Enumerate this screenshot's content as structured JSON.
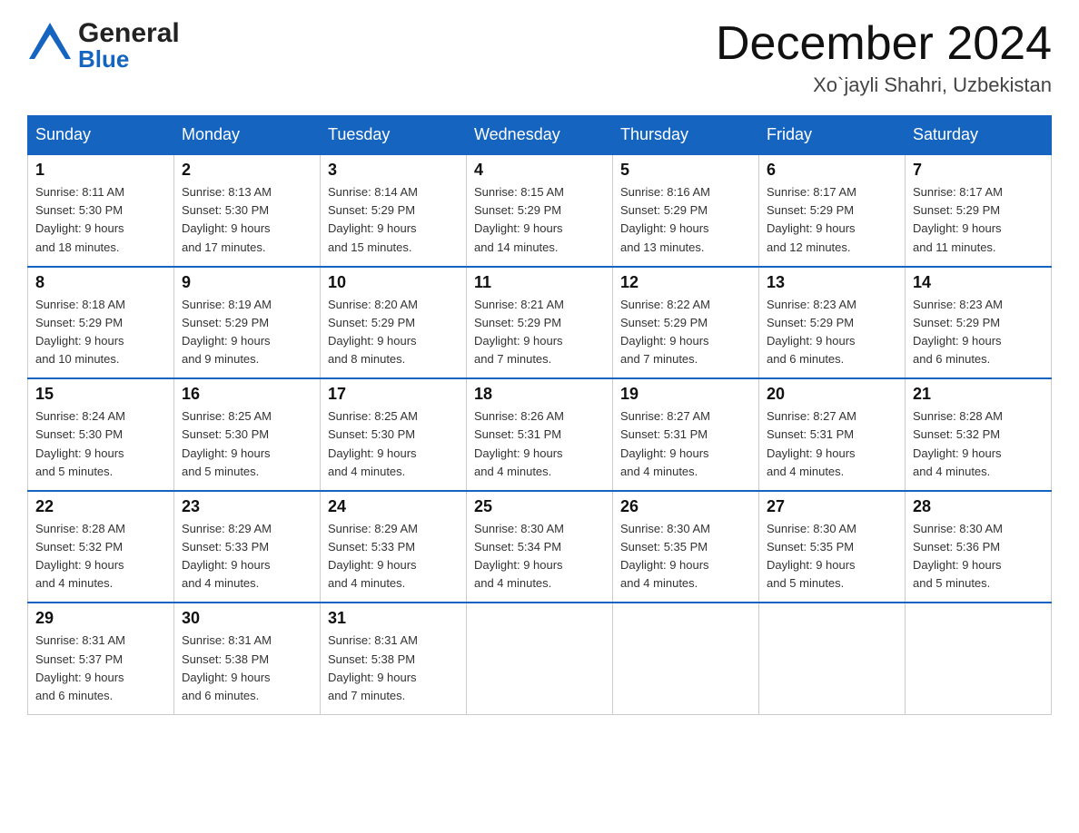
{
  "header": {
    "logo_general": "General",
    "logo_blue": "Blue",
    "month_title": "December 2024",
    "location": "Xo`jayli Shahri, Uzbekistan"
  },
  "days_of_week": [
    "Sunday",
    "Monday",
    "Tuesday",
    "Wednesday",
    "Thursday",
    "Friday",
    "Saturday"
  ],
  "weeks": [
    [
      {
        "day": "1",
        "sunrise": "8:11 AM",
        "sunset": "5:30 PM",
        "daylight": "9 hours and 18 minutes."
      },
      {
        "day": "2",
        "sunrise": "8:13 AM",
        "sunset": "5:30 PM",
        "daylight": "9 hours and 17 minutes."
      },
      {
        "day": "3",
        "sunrise": "8:14 AM",
        "sunset": "5:29 PM",
        "daylight": "9 hours and 15 minutes."
      },
      {
        "day": "4",
        "sunrise": "8:15 AM",
        "sunset": "5:29 PM",
        "daylight": "9 hours and 14 minutes."
      },
      {
        "day": "5",
        "sunrise": "8:16 AM",
        "sunset": "5:29 PM",
        "daylight": "9 hours and 13 minutes."
      },
      {
        "day": "6",
        "sunrise": "8:17 AM",
        "sunset": "5:29 PM",
        "daylight": "9 hours and 12 minutes."
      },
      {
        "day": "7",
        "sunrise": "8:17 AM",
        "sunset": "5:29 PM",
        "daylight": "9 hours and 11 minutes."
      }
    ],
    [
      {
        "day": "8",
        "sunrise": "8:18 AM",
        "sunset": "5:29 PM",
        "daylight": "9 hours and 10 minutes."
      },
      {
        "day": "9",
        "sunrise": "8:19 AM",
        "sunset": "5:29 PM",
        "daylight": "9 hours and 9 minutes."
      },
      {
        "day": "10",
        "sunrise": "8:20 AM",
        "sunset": "5:29 PM",
        "daylight": "9 hours and 8 minutes."
      },
      {
        "day": "11",
        "sunrise": "8:21 AM",
        "sunset": "5:29 PM",
        "daylight": "9 hours and 7 minutes."
      },
      {
        "day": "12",
        "sunrise": "8:22 AM",
        "sunset": "5:29 PM",
        "daylight": "9 hours and 7 minutes."
      },
      {
        "day": "13",
        "sunrise": "8:23 AM",
        "sunset": "5:29 PM",
        "daylight": "9 hours and 6 minutes."
      },
      {
        "day": "14",
        "sunrise": "8:23 AM",
        "sunset": "5:29 PM",
        "daylight": "9 hours and 6 minutes."
      }
    ],
    [
      {
        "day": "15",
        "sunrise": "8:24 AM",
        "sunset": "5:30 PM",
        "daylight": "9 hours and 5 minutes."
      },
      {
        "day": "16",
        "sunrise": "8:25 AM",
        "sunset": "5:30 PM",
        "daylight": "9 hours and 5 minutes."
      },
      {
        "day": "17",
        "sunrise": "8:25 AM",
        "sunset": "5:30 PM",
        "daylight": "9 hours and 4 minutes."
      },
      {
        "day": "18",
        "sunrise": "8:26 AM",
        "sunset": "5:31 PM",
        "daylight": "9 hours and 4 minutes."
      },
      {
        "day": "19",
        "sunrise": "8:27 AM",
        "sunset": "5:31 PM",
        "daylight": "9 hours and 4 minutes."
      },
      {
        "day": "20",
        "sunrise": "8:27 AM",
        "sunset": "5:31 PM",
        "daylight": "9 hours and 4 minutes."
      },
      {
        "day": "21",
        "sunrise": "8:28 AM",
        "sunset": "5:32 PM",
        "daylight": "9 hours and 4 minutes."
      }
    ],
    [
      {
        "day": "22",
        "sunrise": "8:28 AM",
        "sunset": "5:32 PM",
        "daylight": "9 hours and 4 minutes."
      },
      {
        "day": "23",
        "sunrise": "8:29 AM",
        "sunset": "5:33 PM",
        "daylight": "9 hours and 4 minutes."
      },
      {
        "day": "24",
        "sunrise": "8:29 AM",
        "sunset": "5:33 PM",
        "daylight": "9 hours and 4 minutes."
      },
      {
        "day": "25",
        "sunrise": "8:30 AM",
        "sunset": "5:34 PM",
        "daylight": "9 hours and 4 minutes."
      },
      {
        "day": "26",
        "sunrise": "8:30 AM",
        "sunset": "5:35 PM",
        "daylight": "9 hours and 4 minutes."
      },
      {
        "day": "27",
        "sunrise": "8:30 AM",
        "sunset": "5:35 PM",
        "daylight": "9 hours and 5 minutes."
      },
      {
        "day": "28",
        "sunrise": "8:30 AM",
        "sunset": "5:36 PM",
        "daylight": "9 hours and 5 minutes."
      }
    ],
    [
      {
        "day": "29",
        "sunrise": "8:31 AM",
        "sunset": "5:37 PM",
        "daylight": "9 hours and 6 minutes."
      },
      {
        "day": "30",
        "sunrise": "8:31 AM",
        "sunset": "5:38 PM",
        "daylight": "9 hours and 6 minutes."
      },
      {
        "day": "31",
        "sunrise": "8:31 AM",
        "sunset": "5:38 PM",
        "daylight": "9 hours and 7 minutes."
      },
      null,
      null,
      null,
      null
    ]
  ],
  "labels": {
    "sunrise_prefix": "Sunrise: ",
    "sunset_prefix": "Sunset: ",
    "daylight_prefix": "Daylight: "
  }
}
